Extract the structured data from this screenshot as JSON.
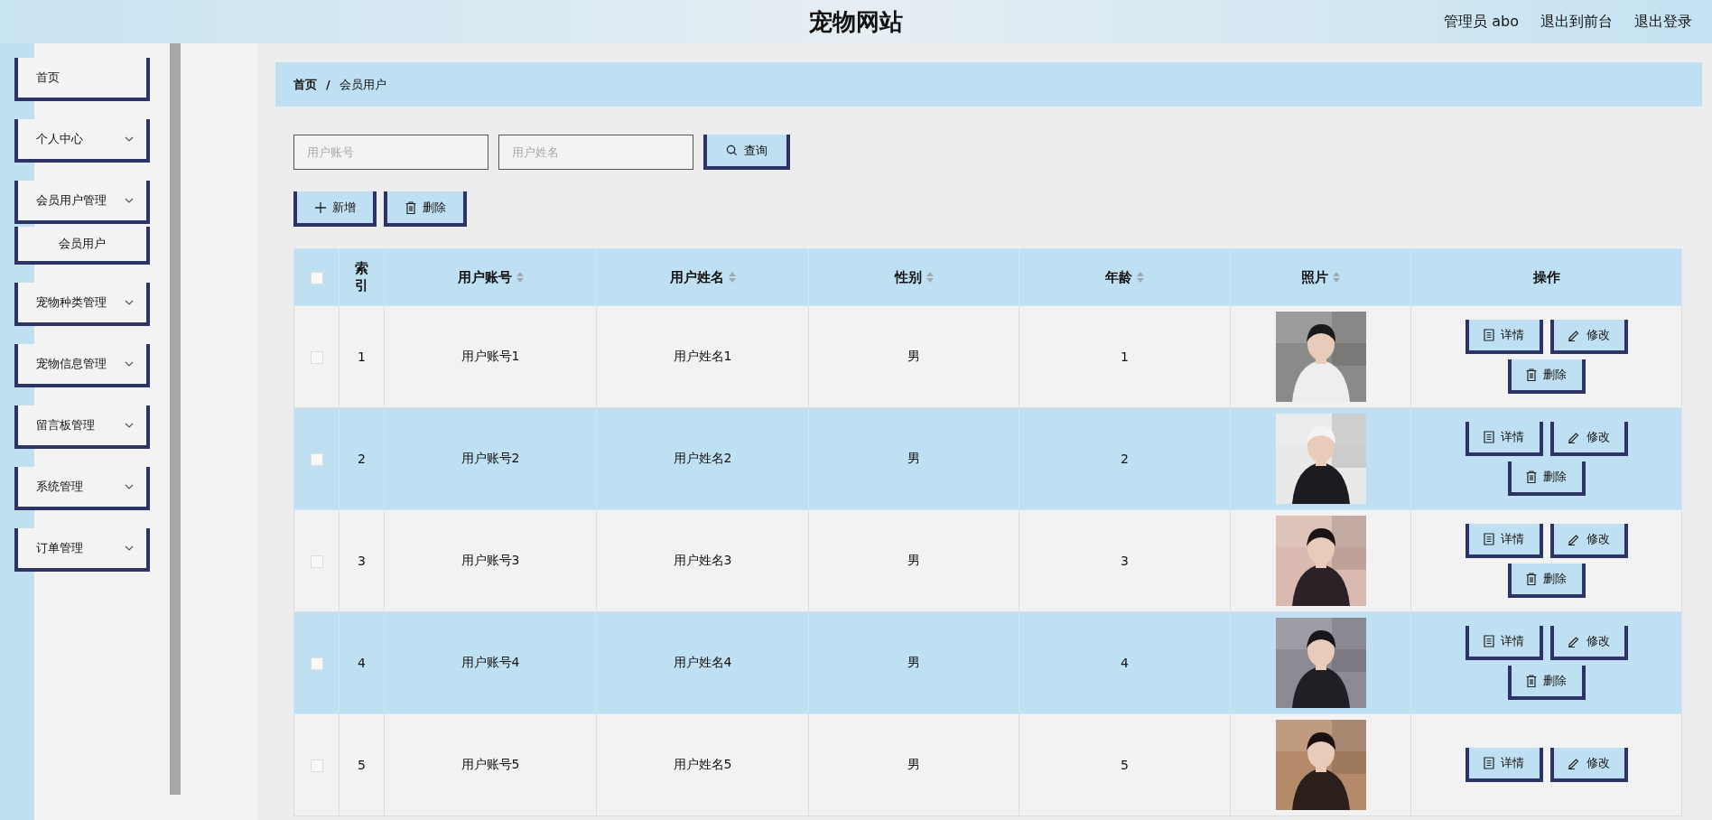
{
  "header": {
    "title": "宠物网站",
    "links": [
      "管理员 abo",
      "退出到前台",
      "退出登录"
    ]
  },
  "sidebar": {
    "items": [
      {
        "label": "首页",
        "kind": "link"
      },
      {
        "label": "个人中心",
        "kind": "group"
      },
      {
        "label": "会员用户管理",
        "kind": "group",
        "children": [
          {
            "label": "会员用户"
          }
        ]
      },
      {
        "label": "宠物种类管理",
        "kind": "group"
      },
      {
        "label": "宠物信息管理",
        "kind": "group"
      },
      {
        "label": "留言板管理",
        "kind": "group"
      },
      {
        "label": "系统管理",
        "kind": "group"
      },
      {
        "label": "订单管理",
        "kind": "group"
      }
    ]
  },
  "breadcrumb": [
    "首页",
    "/",
    "会员用户"
  ],
  "search": {
    "fields": [
      {
        "placeholder": "用户账号"
      },
      {
        "placeholder": "用户姓名"
      }
    ],
    "button": {
      "label": "查询"
    }
  },
  "actions": [
    {
      "label": "新增"
    },
    {
      "label": "删除"
    }
  ],
  "table": {
    "select_all": {
      "checked": false
    },
    "columns": [
      {
        "label": "索引",
        "sortable": false
      },
      {
        "label": "用户账号",
        "sortable": true
      },
      {
        "label": "用户姓名",
        "sortable": true
      },
      {
        "label": "性别",
        "sortable": true
      },
      {
        "label": "年龄",
        "sortable": true
      },
      {
        "label": "照片",
        "sortable": true
      },
      {
        "label": "操作",
        "sortable": false
      }
    ],
    "rows": [
      {
        "checked": false,
        "cells": [
          "1",
          "用户账号1",
          "用户姓名1",
          "男",
          "1"
        ],
        "photo": {
          "kind": "picture"
        },
        "actions": [
          {
            "label": "详情"
          },
          {
            "label": "修改"
          },
          {
            "label": "删除"
          }
        ]
      },
      {
        "checked": false,
        "cells": [
          "2",
          "用户账号2",
          "用户姓名2",
          "男",
          "2"
        ],
        "photo": {
          "kind": "picture"
        },
        "actions": [
          {
            "label": "详情"
          },
          {
            "label": "修改"
          },
          {
            "label": "删除"
          }
        ]
      },
      {
        "checked": false,
        "cells": [
          "3",
          "用户账号3",
          "用户姓名3",
          "男",
          "3"
        ],
        "photo": {
          "kind": "picture"
        },
        "actions": [
          {
            "label": "详情"
          },
          {
            "label": "修改"
          },
          {
            "label": "删除"
          }
        ]
      },
      {
        "checked": false,
        "cells": [
          "4",
          "用户账号4",
          "用户姓名4",
          "男",
          "4"
        ],
        "photo": {
          "kind": "picture"
        },
        "actions": [
          {
            "label": "详情"
          },
          {
            "label": "修改"
          },
          {
            "label": "删除"
          }
        ]
      },
      {
        "checked": false,
        "cells": [
          "5",
          "用户账号5",
          "用户姓名5",
          "男",
          "5"
        ],
        "photo": {
          "kind": "picture"
        },
        "actions": [
          {
            "label": "详情"
          },
          {
            "label": "修改"
          }
        ]
      }
    ]
  }
}
